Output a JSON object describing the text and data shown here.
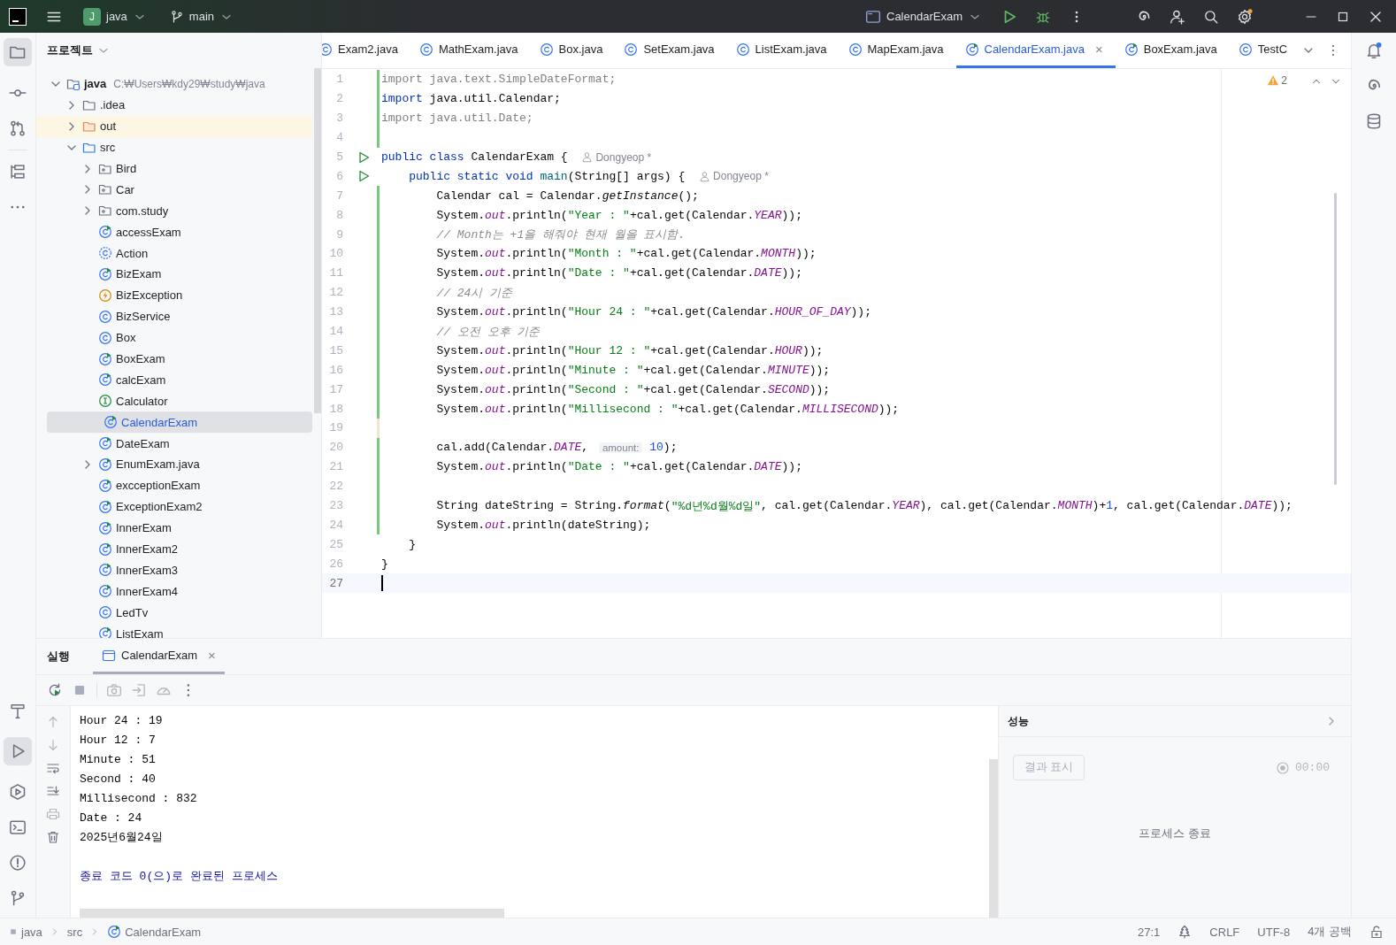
{
  "title_bar": {
    "project": {
      "badge": "J",
      "label": "java"
    },
    "branch": "main",
    "run_config": "CalendarExam"
  },
  "project": {
    "title": "프로젝트",
    "tree": [
      {
        "label": "java",
        "location": "C:₩Users₩kdy29₩study₩java",
        "kind": "module",
        "expanded": true,
        "selected": false,
        "children": [
          {
            "label": ".idea",
            "kind": "folder",
            "expanded": false,
            "selected": false
          },
          {
            "label": "out",
            "kind": "excluded",
            "expanded": false,
            "selected": false
          },
          {
            "label": "src",
            "kind": "source",
            "expanded": true,
            "selected": false,
            "children": [
              {
                "label": "Bird",
                "kind": "package",
                "expanded": false,
                "selected": false
              },
              {
                "label": "Car",
                "kind": "package",
                "expanded": false,
                "selected": false
              },
              {
                "label": "com.study",
                "kind": "package",
                "expanded": false,
                "selected": false
              },
              {
                "label": "accessExam",
                "kind": "main",
                "selected": false
              },
              {
                "label": "Action",
                "kind": "abstract",
                "selected": false
              },
              {
                "label": "BizExam",
                "kind": "main",
                "selected": false
              },
              {
                "label": "BizException",
                "kind": "exception",
                "selected": false
              },
              {
                "label": "BizService",
                "kind": "class",
                "selected": false
              },
              {
                "label": "Box",
                "kind": "class",
                "selected": false
              },
              {
                "label": "BoxExam",
                "kind": "main",
                "selected": false
              },
              {
                "label": "calcExam",
                "kind": "main",
                "selected": false
              },
              {
                "label": "Calculator",
                "kind": "interface",
                "selected": false
              },
              {
                "label": "CalendarExam",
                "kind": "main",
                "selected": true
              },
              {
                "label": "DateExam",
                "kind": "main",
                "selected": false
              },
              {
                "label": "EnumExam.java",
                "kind": "main",
                "expanded": false,
                "selected": false
              },
              {
                "label": "excceptionExam",
                "kind": "main",
                "selected": false
              },
              {
                "label": "ExceptionExam2",
                "kind": "main",
                "selected": false
              },
              {
                "label": "InnerExam",
                "kind": "main",
                "selected": false
              },
              {
                "label": "InnerExam2",
                "kind": "main",
                "selected": false
              },
              {
                "label": "InnerExam3",
                "kind": "main",
                "selected": false
              },
              {
                "label": "InnerExam4",
                "kind": "main",
                "selected": false
              },
              {
                "label": "LedTv",
                "kind": "class",
                "selected": false
              },
              {
                "label": "ListExam",
                "kind": "main",
                "selected": false
              }
            ]
          }
        ]
      }
    ]
  },
  "editor": {
    "tabs": [
      {
        "label": "Exam2.java",
        "kind": "class",
        "selected": false
      },
      {
        "label": "MathExam.java",
        "kind": "class",
        "selected": false
      },
      {
        "label": "Box.java",
        "kind": "class",
        "selected": false
      },
      {
        "label": "SetExam.java",
        "kind": "class",
        "selected": false
      },
      {
        "label": "ListExam.java",
        "kind": "class",
        "selected": false
      },
      {
        "label": "MapExam.java",
        "kind": "class",
        "selected": false
      },
      {
        "label": "CalendarExam.java",
        "kind": "main",
        "selected": true,
        "close": "×"
      },
      {
        "label": "BoxExam.java",
        "kind": "main",
        "selected": false
      },
      {
        "label": "TestC",
        "kind": "class",
        "selected": false
      }
    ],
    "warnings": "2",
    "lines": [
      {
        "number": "1",
        "added": true,
        "modified": false,
        "run": false,
        "current": false,
        "tokens": [
          {
            "kind": "unused",
            "text": "import java.text.SimpleDateFormat;"
          }
        ]
      },
      {
        "number": "2",
        "added": true,
        "modified": false,
        "run": false,
        "current": false,
        "tokens": [
          {
            "kind": "kw",
            "text": "import"
          },
          {
            "kind": "plain",
            "text": " java.util.Calendar;"
          }
        ]
      },
      {
        "number": "3",
        "added": true,
        "modified": false,
        "run": false,
        "current": false,
        "tokens": [
          {
            "kind": "unused",
            "text": "import java.util.Date;"
          }
        ]
      },
      {
        "number": "4",
        "added": true,
        "modified": false,
        "run": false,
        "current": false
      },
      {
        "number": "5",
        "added": false,
        "modified": false,
        "run": true,
        "current": false,
        "tokens": [
          {
            "kind": "kw",
            "text": "public class "
          },
          {
            "kind": "plain",
            "text": "CalendarExam { "
          },
          {
            "kind": "author",
            "text": "Dongyeop *"
          }
        ]
      },
      {
        "number": "6",
        "added": false,
        "modified": false,
        "run": true,
        "current": false,
        "tokens": [
          {
            "kind": "kw",
            "text": "    public static void "
          },
          {
            "kind": "method",
            "text": "main"
          },
          {
            "kind": "plain",
            "text": "(String[] args) { "
          },
          {
            "kind": "author",
            "text": "Dongyeop *"
          }
        ]
      },
      {
        "number": "7",
        "added": true,
        "modified": false,
        "run": false,
        "current": false,
        "tokens": [
          {
            "kind": "plain",
            "text": "        Calendar cal = Calendar."
          },
          {
            "kind": "italic",
            "text": "getInstance"
          },
          {
            "kind": "plain",
            "text": "();"
          }
        ]
      },
      {
        "number": "8",
        "added": true,
        "modified": false,
        "run": false,
        "current": false,
        "tokens": [
          {
            "kind": "plain",
            "text": "        System."
          },
          {
            "kind": "field",
            "text": "out"
          },
          {
            "kind": "plain",
            "text": ".println("
          },
          {
            "kind": "str",
            "text": "\"Year : \""
          },
          {
            "kind": "plain",
            "text": "+cal.get(Calendar."
          },
          {
            "kind": "field",
            "text": "YEAR"
          },
          {
            "kind": "plain",
            "text": "));"
          }
        ]
      },
      {
        "number": "9",
        "added": true,
        "modified": false,
        "run": false,
        "current": false,
        "tokens": [
          {
            "kind": "comment",
            "text": "        // Month는 +1을 해줘야 현재 월을 표시함."
          }
        ]
      },
      {
        "number": "10",
        "added": true,
        "modified": false,
        "run": false,
        "current": false,
        "tokens": [
          {
            "kind": "plain",
            "text": "        System."
          },
          {
            "kind": "field",
            "text": "out"
          },
          {
            "kind": "plain",
            "text": ".println("
          },
          {
            "kind": "str",
            "text": "\"Month : \""
          },
          {
            "kind": "plain",
            "text": "+cal.get(Calendar."
          },
          {
            "kind": "field",
            "text": "MONTH"
          },
          {
            "kind": "plain",
            "text": "));"
          }
        ]
      },
      {
        "number": "11",
        "added": true,
        "modified": false,
        "run": false,
        "current": false,
        "tokens": [
          {
            "kind": "plain",
            "text": "        System."
          },
          {
            "kind": "field",
            "text": "out"
          },
          {
            "kind": "plain",
            "text": ".println("
          },
          {
            "kind": "str",
            "text": "\"Date : \""
          },
          {
            "kind": "plain",
            "text": "+cal.get(Calendar."
          },
          {
            "kind": "field",
            "text": "DATE"
          },
          {
            "kind": "plain",
            "text": "));"
          }
        ]
      },
      {
        "number": "12",
        "added": true,
        "modified": false,
        "run": false,
        "current": false,
        "tokens": [
          {
            "kind": "comment",
            "text": "        // 24시 기준"
          }
        ]
      },
      {
        "number": "13",
        "added": true,
        "modified": false,
        "run": false,
        "current": false,
        "tokens": [
          {
            "kind": "plain",
            "text": "        System."
          },
          {
            "kind": "field",
            "text": "out"
          },
          {
            "kind": "plain",
            "text": ".println("
          },
          {
            "kind": "str",
            "text": "\"Hour 24 : \""
          },
          {
            "kind": "plain",
            "text": "+cal.get(Calendar."
          },
          {
            "kind": "field",
            "text": "HOUR_OF_DAY"
          },
          {
            "kind": "plain",
            "text": "));"
          }
        ]
      },
      {
        "number": "14",
        "added": true,
        "modified": false,
        "run": false,
        "current": false,
        "tokens": [
          {
            "kind": "comment",
            "text": "        // 오전 오후 기준"
          }
        ]
      },
      {
        "number": "15",
        "added": true,
        "modified": false,
        "run": false,
        "current": false,
        "tokens": [
          {
            "kind": "plain",
            "text": "        System."
          },
          {
            "kind": "field",
            "text": "out"
          },
          {
            "kind": "plain",
            "text": ".println("
          },
          {
            "kind": "str",
            "text": "\"Hour 12 : \""
          },
          {
            "kind": "plain",
            "text": "+cal.get(Calendar."
          },
          {
            "kind": "field",
            "text": "HOUR"
          },
          {
            "kind": "plain",
            "text": "));"
          }
        ]
      },
      {
        "number": "16",
        "added": true,
        "modified": false,
        "run": false,
        "current": false,
        "tokens": [
          {
            "kind": "plain",
            "text": "        System."
          },
          {
            "kind": "field",
            "text": "out"
          },
          {
            "kind": "plain",
            "text": ".println("
          },
          {
            "kind": "str",
            "text": "\"Minute : \""
          },
          {
            "kind": "plain",
            "text": "+cal.get(Calendar."
          },
          {
            "kind": "field",
            "text": "MINUTE"
          },
          {
            "kind": "plain",
            "text": "));"
          }
        ]
      },
      {
        "number": "17",
        "added": true,
        "modified": false,
        "run": false,
        "current": false,
        "tokens": [
          {
            "kind": "plain",
            "text": "        System."
          },
          {
            "kind": "field",
            "text": "out"
          },
          {
            "kind": "plain",
            "text": ".println("
          },
          {
            "kind": "str",
            "text": "\"Second : \""
          },
          {
            "kind": "plain",
            "text": "+cal.get(Calendar."
          },
          {
            "kind": "field",
            "text": "SECOND"
          },
          {
            "kind": "plain",
            "text": "));"
          }
        ]
      },
      {
        "number": "18",
        "added": true,
        "modified": false,
        "run": false,
        "current": false,
        "tokens": [
          {
            "kind": "plain",
            "text": "        System."
          },
          {
            "kind": "field",
            "text": "out"
          },
          {
            "kind": "plain",
            "text": ".println("
          },
          {
            "kind": "str",
            "text": "\"Millisecond : \""
          },
          {
            "kind": "plain",
            "text": "+cal.get(Calendar."
          },
          {
            "kind": "field",
            "text": "MILLISECOND"
          },
          {
            "kind": "plain",
            "text": "));"
          }
        ]
      },
      {
        "number": "19",
        "added": false,
        "modified": true,
        "run": false,
        "current": false
      },
      {
        "number": "20",
        "added": true,
        "modified": false,
        "run": false,
        "current": false,
        "tokens": [
          {
            "kind": "plain",
            "text": "        cal.add(Calendar."
          },
          {
            "kind": "field",
            "text": "DATE"
          },
          {
            "kind": "plain",
            "text": ", "
          },
          {
            "kind": "param",
            "text": "amount:"
          },
          {
            "kind": "num",
            "text": " 10"
          },
          {
            "kind": "plain",
            "text": ");"
          }
        ]
      },
      {
        "number": "21",
        "added": true,
        "modified": false,
        "run": false,
        "current": false,
        "tokens": [
          {
            "kind": "plain",
            "text": "        System."
          },
          {
            "kind": "field",
            "text": "out"
          },
          {
            "kind": "plain",
            "text": ".println("
          },
          {
            "kind": "str",
            "text": "\"Date : \""
          },
          {
            "kind": "plain",
            "text": "+cal.get(Calendar."
          },
          {
            "kind": "field",
            "text": "DATE"
          },
          {
            "kind": "plain",
            "text": "));"
          }
        ]
      },
      {
        "number": "22",
        "added": true,
        "modified": false,
        "run": false,
        "current": false
      },
      {
        "number": "23",
        "added": true,
        "modified": false,
        "run": false,
        "current": false,
        "tokens": [
          {
            "kind": "plain",
            "text": "        String dateString = String."
          },
          {
            "kind": "italic",
            "text": "format"
          },
          {
            "kind": "plain",
            "text": "("
          },
          {
            "kind": "str",
            "text": "\"%d년%d월%d일\""
          },
          {
            "kind": "plain",
            "text": ", cal.get(Calendar."
          },
          {
            "kind": "field",
            "text": "YEAR"
          },
          {
            "kind": "plain",
            "text": "), cal.get(Calendar."
          },
          {
            "kind": "field",
            "text": "MONTH"
          },
          {
            "kind": "plain",
            "text": ")+"
          },
          {
            "kind": "num",
            "text": "1"
          },
          {
            "kind": "plain",
            "text": ", cal.get(Calendar."
          },
          {
            "kind": "field",
            "text": "DATE"
          },
          {
            "kind": "plain",
            "text": "));"
          }
        ]
      },
      {
        "number": "24",
        "added": true,
        "modified": false,
        "run": false,
        "current": false,
        "tokens": [
          {
            "kind": "plain",
            "text": "        System."
          },
          {
            "kind": "field",
            "text": "out"
          },
          {
            "kind": "plain",
            "text": ".println(dateString);"
          }
        ]
      },
      {
        "number": "25",
        "added": false,
        "modified": false,
        "run": false,
        "current": false,
        "tokens": [
          {
            "kind": "plain",
            "text": "    }"
          }
        ]
      },
      {
        "number": "26",
        "added": false,
        "modified": false,
        "run": false,
        "current": false,
        "tokens": [
          {
            "kind": "plain",
            "text": "}"
          }
        ]
      },
      {
        "number": "27",
        "added": false,
        "modified": false,
        "run": false,
        "current": true
      }
    ]
  },
  "run_panel": {
    "title": "실행",
    "tabs": [
      {
        "label": "CalendarExam",
        "selected": true,
        "close": "×"
      }
    ],
    "console": [
      {
        "kind": "output",
        "text": "Hour 24 : 19"
      },
      {
        "kind": "output",
        "text": "Hour 12 : 7"
      },
      {
        "kind": "output",
        "text": "Minute : 51"
      },
      {
        "kind": "output",
        "text": "Second : 40"
      },
      {
        "kind": "output",
        "text": "Millisecond : 832"
      },
      {
        "kind": "output",
        "text": "Date : 24"
      },
      {
        "kind": "output",
        "text": "2025년6월24일"
      },
      {
        "kind": "exit",
        "text": "종료 코드 0(으)로 완료된 프로세스"
      }
    ],
    "performance": {
      "title": "성능",
      "button": {
        "label": "결과 표시",
        "disabled": true
      },
      "timer": "00:00",
      "status": "프로세스 종료"
    }
  },
  "status_bar": {
    "breadcrumbs": [
      {
        "label": "java",
        "kind": "module"
      },
      {
        "label": "src",
        "kind": "folder"
      },
      {
        "label": "CalendarExam",
        "kind": "main"
      }
    ],
    "position": "27:1",
    "line_ending": "CRLF",
    "encoding": "UTF-8",
    "indent": "4개 공백"
  }
}
